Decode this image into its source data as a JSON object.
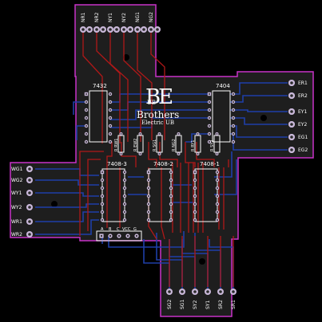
{
  "colors": {
    "background": "#000000",
    "board_fill": "#1e1e1e",
    "board_outline": "#c832c8",
    "trace_top": "#b01818",
    "trace_bottom": "#1f3fa8",
    "silkscreen": "#ffffff",
    "pad_ring": "#c9b8d9",
    "pad_hole": "#2a2a2a"
  },
  "logo": {
    "letters": "BE",
    "sub_letters": "UB",
    "company": "Brothers",
    "tagline": "Electric UB"
  },
  "chips": {
    "u7432": "7432",
    "u7404": "7404",
    "u7408_3": "7408-3",
    "u7408_2": "7408-2",
    "u7408_1": "7408-1"
  },
  "resistors": [
    "R RW1",
    "R EW2",
    "R SG1",
    "R NG2",
    "R RY1",
    "R SY2"
  ],
  "header": {
    "pins": [
      "A",
      "B",
      "C",
      "VCC",
      "G"
    ]
  },
  "top_connectors": [
    "NR1",
    "NR2",
    "NY1",
    "NY2",
    "NG1",
    "NG2"
  ],
  "right_connectors": [
    "ER1",
    "ER2",
    "EY1",
    "EY2",
    "EG1",
    "EG2"
  ],
  "left_connectors": [
    "WG1",
    "WG2",
    "WY1",
    "WY2",
    "WR1",
    "WR2"
  ],
  "bottom_connectors": [
    "SG2",
    "SG1",
    "SY2",
    "SY1",
    "SR2",
    "SR1"
  ]
}
